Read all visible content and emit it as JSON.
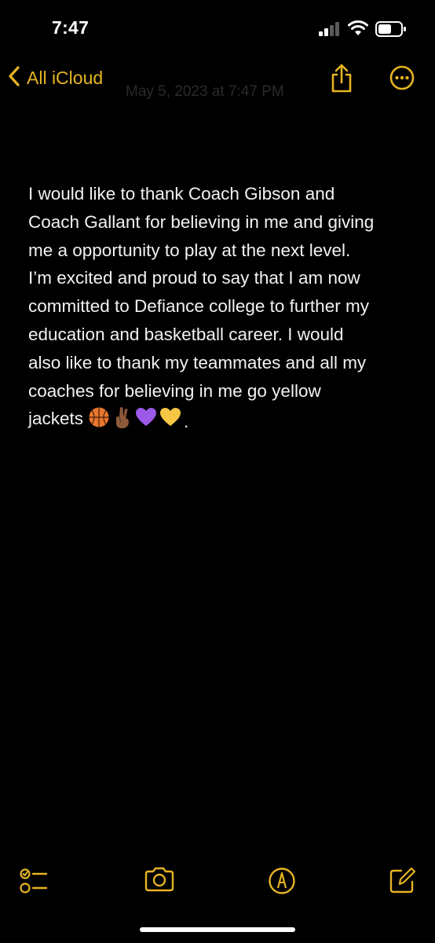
{
  "status_bar": {
    "time": "7:47",
    "icons": [
      "cellular-signal-icon",
      "wifi-icon",
      "battery-icon"
    ]
  },
  "nav": {
    "back_label": "All iCloud",
    "date": "May 5, 2023 at 7:47 PM",
    "share_icon": "share-icon",
    "more_icon": "ellipsis-circle-icon"
  },
  "note": {
    "lines": [
      "I would like to thank Coach Gibson and",
      "Coach Gallant for believing in me and giving",
      "me a opportunity to play at the next level.",
      "I’m excited and proud to say that I am now",
      "committed to Defiance college to further my",
      "education and basketball career. I would",
      "also like to thank my teammates and all my",
      "coaches for believing in me go yellow",
      "jackets"
    ],
    "emojis": [
      "🏀",
      "🤞🏾",
      "💜",
      "💛"
    ],
    "trailing": "."
  },
  "toolbar": {
    "icons": [
      "checklist-icon",
      "camera-icon",
      "markup-icon",
      "compose-icon"
    ]
  },
  "colors": {
    "accent": "#e6b422",
    "background": "#000000",
    "text": "#f2f2f2"
  }
}
